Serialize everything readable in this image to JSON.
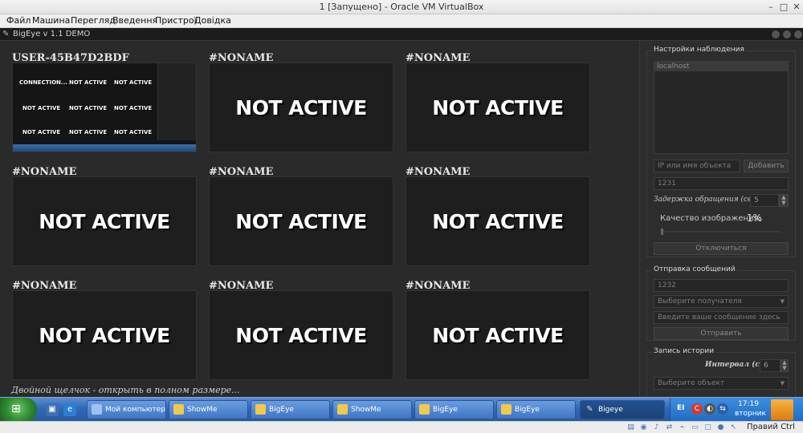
{
  "vbox": {
    "title": "1 [Запущено] - Oracle VM VirtualBox",
    "menu": [
      "Файл",
      "Машина",
      "Перегляд",
      "Введення",
      "Пристрої",
      "Довідка"
    ],
    "host_key": "Правий Ctrl"
  },
  "app": {
    "title": "BigEye v 1.1 DEMO",
    "cells": [
      {
        "name": "USER-45B47D2BDF",
        "status": ""
      },
      {
        "name": "#NONAME",
        "status": "NOT ACTIVE"
      },
      {
        "name": "#NONAME",
        "status": "NOT ACTIVE"
      },
      {
        "name": "#NONAME",
        "status": "NOT ACTIVE"
      },
      {
        "name": "#NONAME",
        "status": "NOT ACTIVE"
      },
      {
        "name": "#NONAME",
        "status": "NOT ACTIVE"
      },
      {
        "name": "#NONAME",
        "status": "NOT ACTIVE"
      },
      {
        "name": "#NONAME",
        "status": "NOT ACTIVE"
      },
      {
        "name": "#NONAME",
        "status": "NOT ACTIVE"
      }
    ],
    "preview": {
      "labels": [
        "CONNECTION...",
        "NOT ACTIVE",
        "NOT ACTIVE",
        "NOT ACTIVE",
        "NOT ACTIVE",
        "NOT ACTIVE",
        "NOT ACTIVE",
        "NOT ACTIVE",
        "NOT ACTIVE"
      ]
    },
    "hint": "Двойной щелчок - открыть в полном размере...",
    "monitoring": {
      "title": "Настройки наблюдения",
      "list_item": "localhost",
      "ip_placeholder": "IP или имя объекта",
      "add_button": "Добавить",
      "port_value": "1231",
      "delay_label": "Задержка обращения (сек):",
      "delay_value": "5",
      "quality_label": "Качество изображения:",
      "quality_value": "1%",
      "quality_level": 0.01,
      "disconnect_button": "Отключиться"
    },
    "messaging": {
      "title": "Отправка сообщений",
      "port_value": "1232",
      "recipient_placeholder": "Выберите получателя",
      "message_placeholder": "Введите ваше сообщение здесь",
      "send_button": "Отправить"
    },
    "history": {
      "title": "Запись истории",
      "interval_label": "Интервал (сек):",
      "interval_value": "6",
      "object_placeholder": "Выберите объект"
    }
  },
  "taskbar": {
    "items": [
      {
        "label": "Мой компьютер",
        "icon": "computer-icon",
        "active": false
      },
      {
        "label": "ShowMe",
        "icon": "folder-icon",
        "active": false
      },
      {
        "label": "BigEye",
        "icon": "folder-icon",
        "active": false
      },
      {
        "label": "ShowMe",
        "icon": "folder-icon",
        "active": false
      },
      {
        "label": "BigEye",
        "icon": "folder-icon",
        "active": false
      },
      {
        "label": "BigEye",
        "icon": "folder-icon",
        "active": false
      },
      {
        "label": "Bigeye",
        "icon": "bigeye-icon",
        "active": true
      }
    ],
    "lang": "EI",
    "clock_time": "17:19",
    "clock_day": "вторник"
  },
  "colors": {
    "app_bg": "#2a2a2a",
    "panel_bg": "#2d2d2d",
    "taskbar": "#3168b6",
    "start": "#2d8a31"
  }
}
